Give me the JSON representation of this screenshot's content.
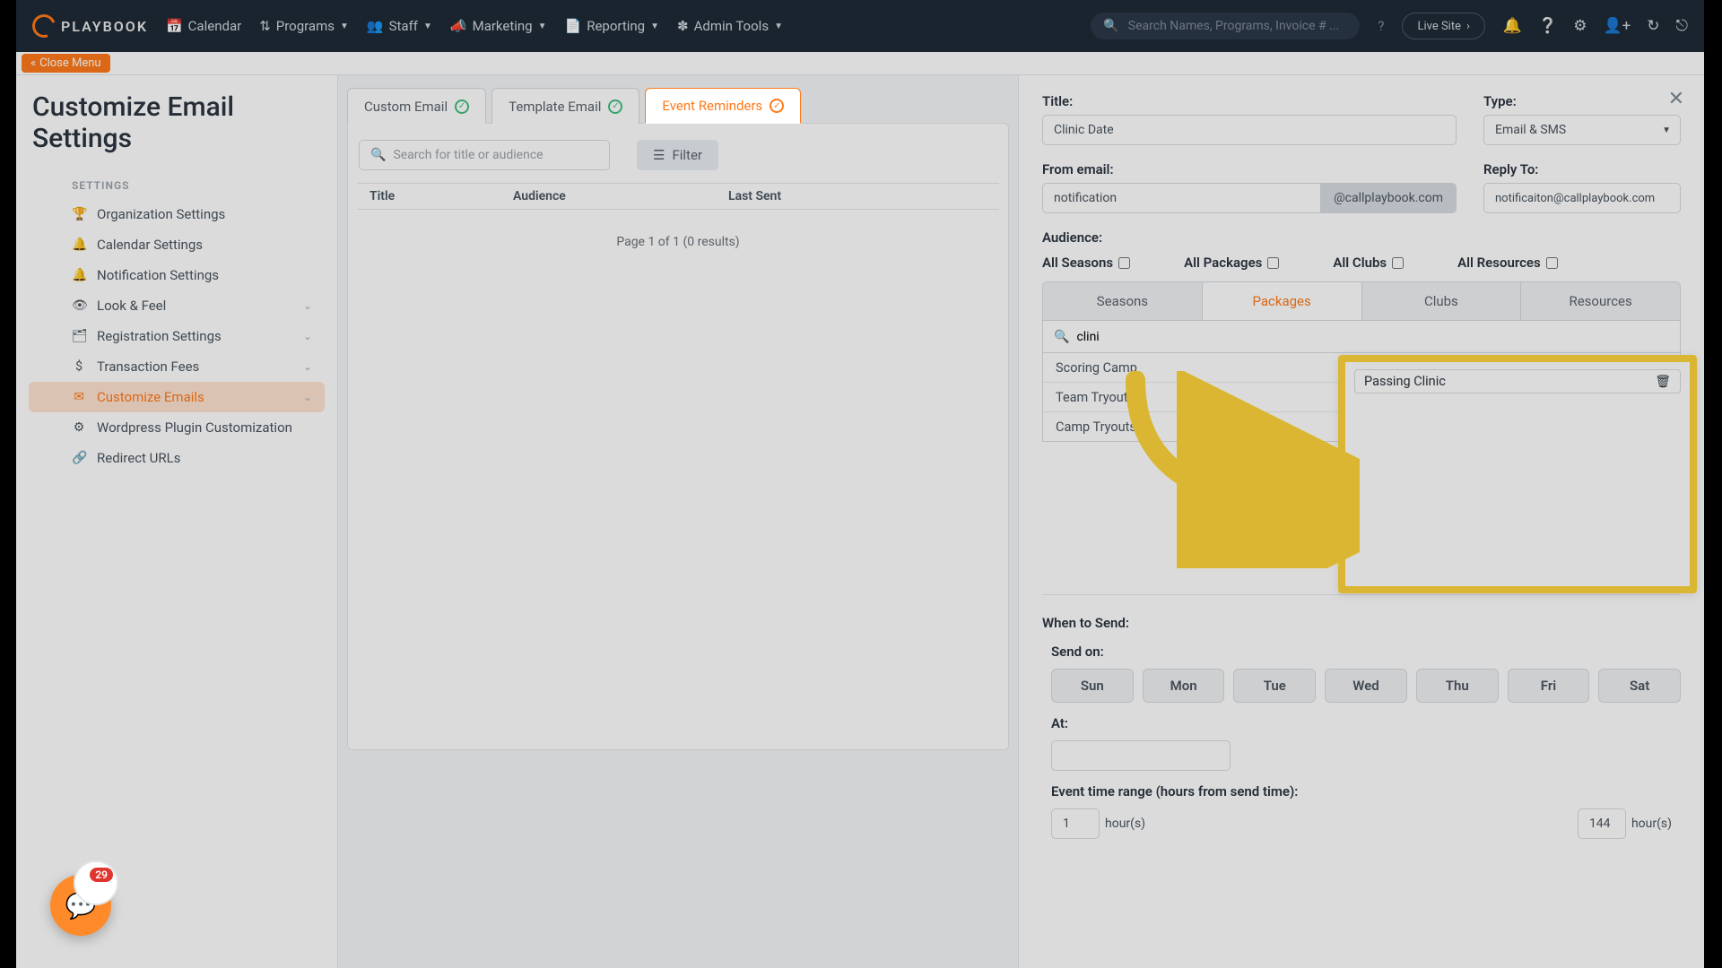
{
  "topnav": {
    "brand": "PLAYBOOK",
    "items": [
      "Calendar",
      "Programs",
      "Staff",
      "Marketing",
      "Reporting",
      "Admin Tools"
    ],
    "search_placeholder": "Search Names, Programs, Invoice # ...",
    "live_site": "Live Site"
  },
  "close_menu": "Close Menu",
  "page_title": "Customize Email Settings",
  "sidebar": {
    "section": "SETTINGS",
    "items": [
      {
        "label": "Organization Settings",
        "icon": "🏆",
        "expand": false
      },
      {
        "label": "Calendar Settings",
        "icon": "🔔",
        "expand": false
      },
      {
        "label": "Notification Settings",
        "icon": "🔔",
        "expand": false
      },
      {
        "label": "Look & Feel",
        "icon": "👁",
        "expand": true
      },
      {
        "label": "Registration Settings",
        "icon": "🗂",
        "expand": true
      },
      {
        "label": "Transaction Fees",
        "icon": "$",
        "expand": true
      },
      {
        "label": "Customize Emails",
        "icon": "✉",
        "expand": true,
        "active": true
      },
      {
        "label": "Wordpress Plugin Customization",
        "icon": "⚙",
        "expand": false
      },
      {
        "label": "Redirect URLs",
        "icon": "🔗",
        "expand": false
      }
    ]
  },
  "tabs": [
    {
      "label": "Custom Email",
      "active": false
    },
    {
      "label": "Template Email",
      "active": false
    },
    {
      "label": "Event Reminders",
      "active": true
    }
  ],
  "list": {
    "search_placeholder": "Search for title or audience",
    "filter": "Filter",
    "headers": {
      "title": "Title",
      "audience": "Audience",
      "last_sent": "Last Sent"
    },
    "pager": "Page 1 of 1 (0 results)"
  },
  "form": {
    "title_lbl": "Title:",
    "title_val": "Clinic Date",
    "type_lbl": "Type:",
    "type_val": "Email & SMS",
    "from_lbl": "From email:",
    "from_val": "notification",
    "from_domain": "@callplaybook.com",
    "reply_lbl": "Reply To:",
    "reply_val": "notificaiton@callplaybook.com",
    "audience_lbl": "Audience:",
    "aud_checks": [
      "All Seasons",
      "All Packages",
      "All Clubs",
      "All Resources"
    ],
    "aud_tabs": [
      "Seasons",
      "Packages",
      "Clubs",
      "Resources"
    ],
    "aud_search_val": "clini",
    "aud_results": [
      "Scoring Camp",
      "Team Tryouts",
      "Camp Tryouts"
    ],
    "selected_item": "Passing Clinic",
    "when_lbl": "When to Send:",
    "send_on_lbl": "Send on:",
    "days": [
      "Sun",
      "Mon",
      "Tue",
      "Wed",
      "Thu",
      "Fri",
      "Sat"
    ],
    "at_lbl": "At:",
    "range_lbl": "Event time range (hours from send time):",
    "range_from": "1",
    "range_to": "144",
    "hours": "hour(s)"
  },
  "chat_count": "29"
}
